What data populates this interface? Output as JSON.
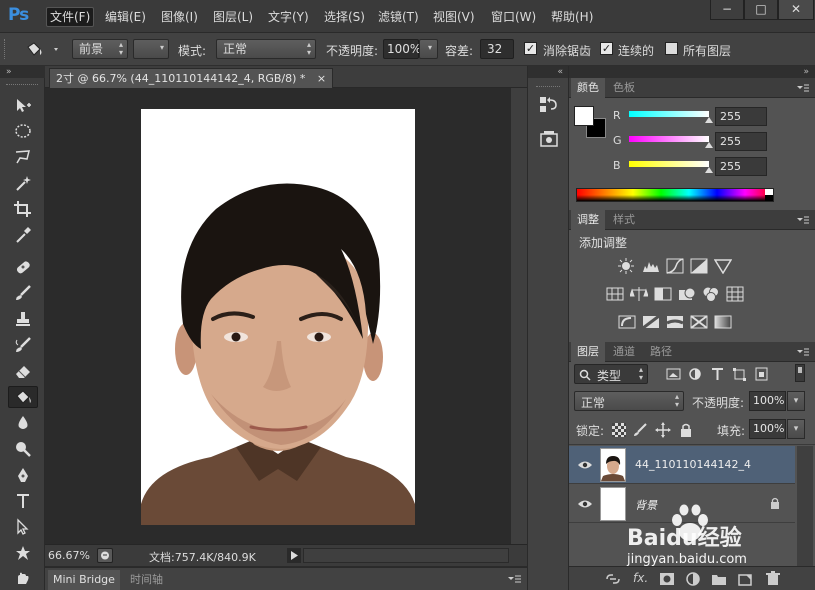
{
  "app": {
    "logo": "Ps"
  },
  "menu": {
    "items": [
      "文件(F)",
      "编辑(E)",
      "图像(I)",
      "图层(L)",
      "文字(Y)",
      "选择(S)",
      "滤镜(T)",
      "视图(V)",
      "窗口(W)",
      "帮助(H)"
    ],
    "active_index": 0
  },
  "window_controls": {
    "minimize": "−",
    "maximize": "□",
    "close": "✕"
  },
  "options": {
    "fill_source": "前景",
    "mode_label": "模式:",
    "mode_value": "正常",
    "opacity_label": "不透明度:",
    "opacity_value": "100%",
    "tolerance_label": "容差:",
    "tolerance_value": "32",
    "antialias_label": "消除锯齿",
    "antialias_checked": true,
    "contiguous_label": "连续的",
    "contiguous_checked": true,
    "all_layers_label": "所有图层",
    "all_layers_checked": false
  },
  "tools": [
    "move-tool",
    "elliptical-marquee-tool",
    "lasso-tool",
    "magic-wand-tool",
    "crop-tool",
    "eyedropper-tool",
    "healing-brush-tool",
    "brush-tool",
    "clone-stamp-tool",
    "history-brush-tool",
    "eraser-tool",
    "paint-bucket-tool",
    "blur-tool",
    "dodge-tool",
    "pen-tool",
    "type-tool",
    "path-selection-tool",
    "custom-shape-tool"
  ],
  "selected_tool_index": 11,
  "document": {
    "tab_title": "2寸 @ 66.7% (44_110110144142_4, RGB/8) *",
    "tab_close": "×",
    "zoom": "66.67%",
    "doc_info": "文档:757.4K/840.9K"
  },
  "bottom_tabs": [
    "Mini Bridge",
    "时间轴"
  ],
  "color_panel": {
    "tabs": [
      "颜色",
      "色板"
    ],
    "channels": [
      {
        "label": "R",
        "value": "255"
      },
      {
        "label": "G",
        "value": "255"
      },
      {
        "label": "B",
        "value": "255"
      }
    ],
    "foreground": "#ffffff",
    "background": "#000000"
  },
  "adjust_panel": {
    "tabs": [
      "调整",
      "样式"
    ],
    "title": "添加调整"
  },
  "layers_panel": {
    "tabs": [
      "图层",
      "通道",
      "路径"
    ],
    "filter_kind": "类型",
    "blend_mode": "正常",
    "opacity_label": "不透明度:",
    "opacity_value": "100%",
    "lock_label": "锁定:",
    "fill_label": "填充:",
    "fill_value": "100%",
    "layers": [
      {
        "name": "44_110110144142_4",
        "selected": true,
        "locked": false
      },
      {
        "name": "背景",
        "selected": false,
        "locked": true
      }
    ]
  },
  "watermark": {
    "text": "Baidu经验",
    "url": "jingyan.baidu.com"
  }
}
